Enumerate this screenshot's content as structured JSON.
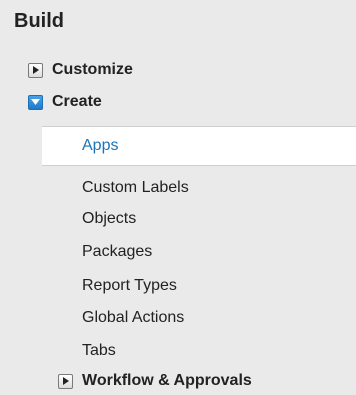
{
  "section": {
    "title": "Build"
  },
  "tree": {
    "customize": {
      "label": "Customize",
      "state": "collapsed",
      "icon": "expand-arrow-icon"
    },
    "create": {
      "label": "Create",
      "state": "expanded",
      "icon": "collapse-arrow-icon"
    },
    "create_items": [
      {
        "label": "Apps",
        "selected": true
      },
      {
        "label": "Custom Labels"
      },
      {
        "label": "Objects"
      },
      {
        "label": "Packages"
      },
      {
        "label": "Report Types"
      },
      {
        "label": "Global Actions"
      },
      {
        "label": "Tabs"
      }
    ],
    "workflow": {
      "label": "Workflow & Approvals",
      "state": "collapsed",
      "icon": "expand-arrow-icon"
    }
  },
  "colors": {
    "background": "#eaeaea",
    "selected_bg": "#ffffff",
    "selected_text": "#1a74ba",
    "expanded_toggle": "#1f79c9"
  }
}
